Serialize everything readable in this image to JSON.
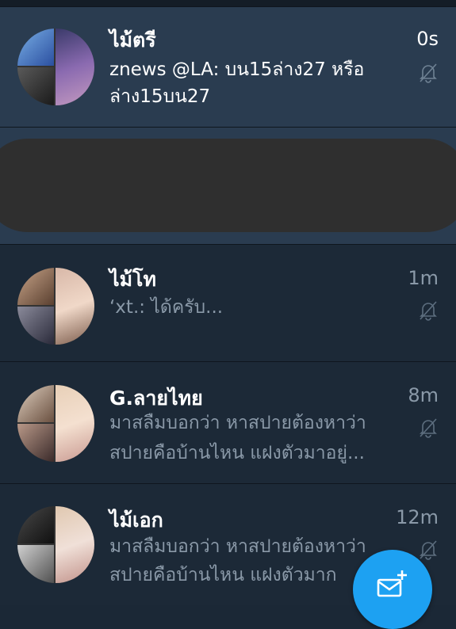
{
  "conversations": [
    {
      "name": "ไม้ตรี",
      "time": "0s",
      "message_lines": [
        "znews @LA: บน15ล่าง27 หรือ",
        "ล่าง15บน27"
      ],
      "unread": true,
      "muted": true
    },
    {
      "name": "ไม้โท",
      "time": "1m",
      "message_lines": [
        "‘xt.: ได้ครับ..."
      ],
      "unread": false,
      "muted": true
    },
    {
      "name": "G.ลายไทย",
      "time": "8m",
      "message_lines": [
        "มาสลืมบอกว่า หาสปายต้องหาว่า",
        "สปายคือบ้านไหน แฝงตัวมาอยู่..."
      ],
      "unread": false,
      "muted": true
    },
    {
      "name": "ไม้เอก",
      "time": "12m",
      "message_lines": [
        "มาสลืมบอกว่า หาสปายต้องหาว่า",
        "สปายคือบ้านไหน แฝงตัวมาก"
      ],
      "unread": false,
      "muted": true
    }
  ],
  "icons": {
    "mute": "bell-off-icon",
    "compose": "new-message-icon"
  },
  "colors": {
    "unread_bg": "#2a3c50",
    "read_bg": "#1c2937",
    "accent": "#1da1f2",
    "muted_text": "#8a99a8"
  }
}
